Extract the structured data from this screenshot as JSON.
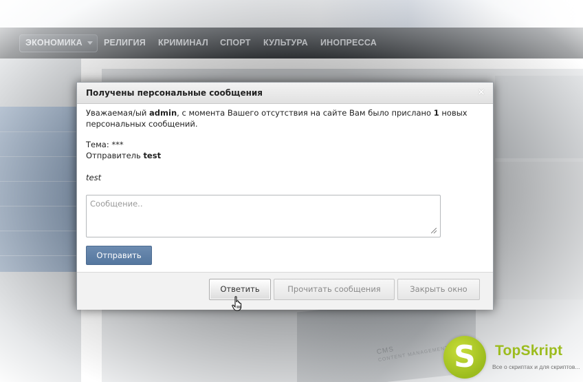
{
  "nav": {
    "items": [
      "ЭКОНОМИКА",
      "РЕЛИГИЯ",
      "КРИМИНАЛ",
      "СПОРТ",
      "КУЛЬТУРА",
      "ИНОПРЕССА"
    ]
  },
  "background": {
    "box_text": "CMS",
    "box_subtext": "CONTENT MANAGEMENT SYSTEM"
  },
  "dialog": {
    "title": "Получены персональные сообщения",
    "close_glyph": "×",
    "greeting_pre": "Уважаемая/ый ",
    "username": "admin",
    "greeting_mid": ", с момента Вашего отсутствия на сайте Вам было прислано ",
    "count": "1",
    "greeting_post": " новых",
    "greeting_line2": "персональных сообщений.",
    "topic_label": "Тема: ",
    "topic_value": "***",
    "sender_label": "Отправитель ",
    "sender_value": "test",
    "message_text": "test",
    "reply_placeholder": "Сообщение..",
    "send_label": "Отправить",
    "reply_label": "Ответить",
    "read_label": "Прочитать сообщения",
    "close_label": "Закрыть окно"
  },
  "watermark": {
    "logo_letter": "S",
    "name": "TopSkript",
    "tagline": "Все о скриптах и для скриптов..."
  },
  "colors": {
    "send_button": "#5f80a8",
    "logo_green": "#9cbc1e"
  }
}
